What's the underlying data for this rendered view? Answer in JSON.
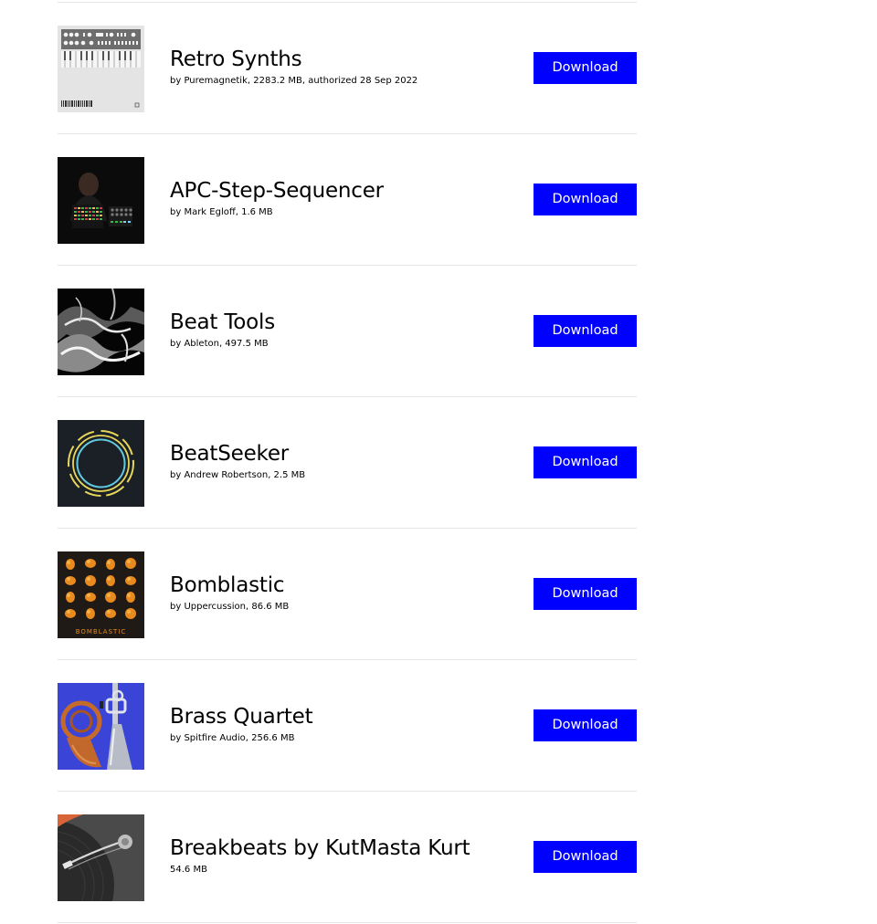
{
  "packs": [
    {
      "title": "Retro Synths",
      "meta": "by Puremagnetik, 2283.2 MB, authorized 28 Sep 2022",
      "button_label": "Download",
      "image": "retro-synths-cover"
    },
    {
      "title": "APC-Step-Sequencer",
      "meta": "by Mark Egloff, 1.6 MB",
      "button_label": "Download",
      "image": "apc-step-sequencer-cover"
    },
    {
      "title": "Beat Tools",
      "meta": "by Ableton, 497.5 MB",
      "button_label": "Download",
      "image": "beat-tools-cover"
    },
    {
      "title": "BeatSeeker",
      "meta": "by Andrew Robertson, 2.5 MB",
      "button_label": "Download",
      "image": "beatseeker-cover"
    },
    {
      "title": "Bomblastic",
      "meta": "by Uppercussion, 86.6 MB",
      "button_label": "Download",
      "image": "bomblastic-cover",
      "cover_text": "BOMBLASTIC"
    },
    {
      "title": "Brass Quartet",
      "meta": "by Spitfire Audio, 256.6 MB",
      "button_label": "Download",
      "image": "brass-quartet-cover"
    },
    {
      "title": "Breakbeats by KutMasta Kurt",
      "meta": "54.6 MB",
      "button_label": "Download",
      "image": "breakbeats-cover"
    }
  ],
  "colors": {
    "button_bg": "#0000ff",
    "button_text": "#ffffff",
    "divider": "#e6e6e6"
  }
}
